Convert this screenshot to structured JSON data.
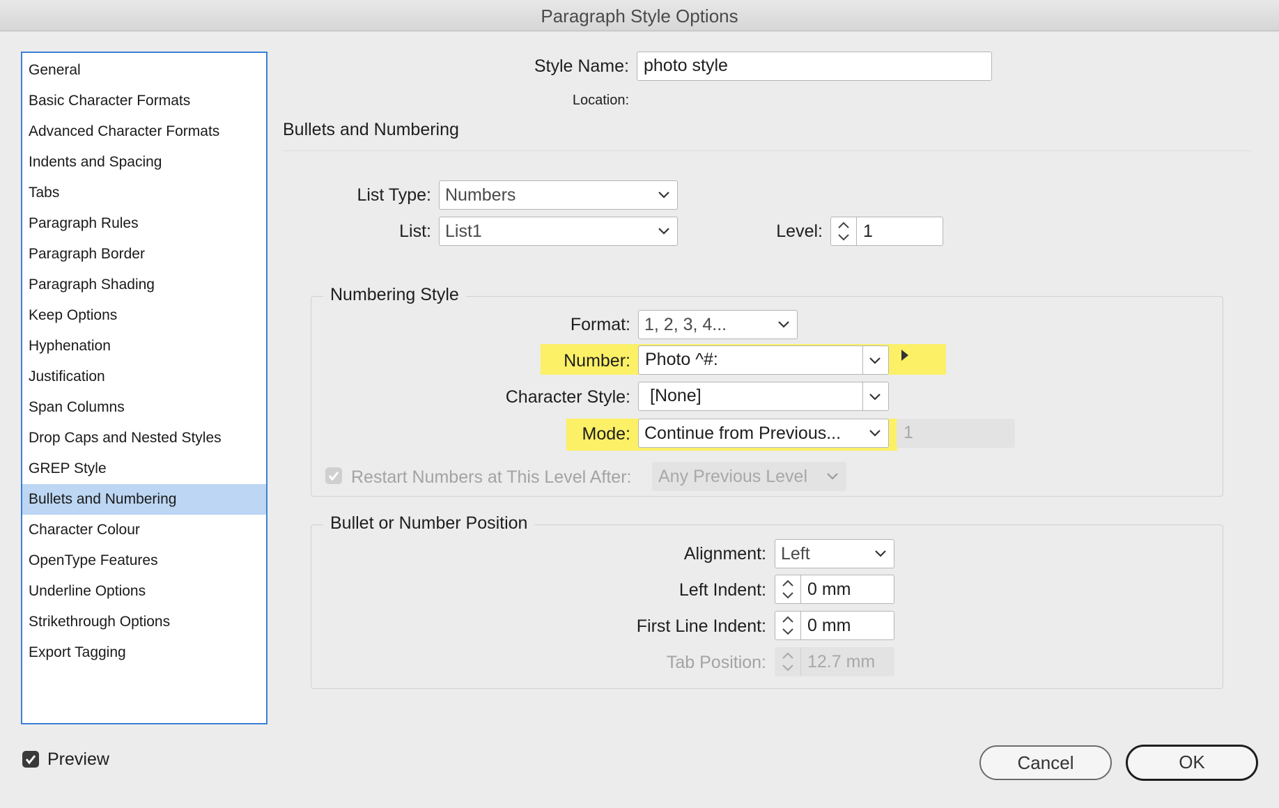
{
  "window": {
    "title": "Paragraph Style Options"
  },
  "sidebar": {
    "items": [
      {
        "label": "General"
      },
      {
        "label": "Basic Character Formats"
      },
      {
        "label": "Advanced Character Formats"
      },
      {
        "label": "Indents and Spacing"
      },
      {
        "label": "Tabs"
      },
      {
        "label": "Paragraph Rules"
      },
      {
        "label": "Paragraph Border"
      },
      {
        "label": "Paragraph Shading"
      },
      {
        "label": "Keep Options"
      },
      {
        "label": "Hyphenation"
      },
      {
        "label": "Justification"
      },
      {
        "label": "Span Columns"
      },
      {
        "label": "Drop Caps and Nested Styles"
      },
      {
        "label": "GREP Style"
      },
      {
        "label": "Bullets and Numbering",
        "selected": true
      },
      {
        "label": "Character Colour"
      },
      {
        "label": "OpenType Features"
      },
      {
        "label": "Underline Options"
      },
      {
        "label": "Strikethrough Options"
      },
      {
        "label": "Export Tagging"
      }
    ]
  },
  "header": {
    "style_name_label": "Style Name:",
    "style_name_value": "photo style",
    "location_label": "Location:",
    "section_title": "Bullets and Numbering"
  },
  "list_settings": {
    "list_type_label": "List Type:",
    "list_type_value": "Numbers",
    "list_label": "List:",
    "list_value": "List1",
    "level_label": "Level:",
    "level_value": "1"
  },
  "numbering_style": {
    "title": "Numbering Style",
    "format_label": "Format:",
    "format_value": "1, 2, 3, 4...",
    "number_label": "Number:",
    "number_value": "Photo ^#:",
    "char_style_label": "Character Style:",
    "char_style_value": "[None]",
    "mode_label": "Mode:",
    "mode_value": "Continue from Previous...",
    "mode_start_value": "1",
    "restart_label": "Restart Numbers at This Level After:",
    "restart_value": "Any Previous Level",
    "restart_checked": true
  },
  "position": {
    "title": "Bullet or Number Position",
    "alignment_label": "Alignment:",
    "alignment_value": "Left",
    "left_indent_label": "Left Indent:",
    "left_indent_value": "0 mm",
    "first_line_label": "First Line Indent:",
    "first_line_value": "0 mm",
    "tab_position_label": "Tab Position:",
    "tab_position_value": "12.7 mm"
  },
  "footer": {
    "preview_label": "Preview",
    "preview_checked": true,
    "cancel_label": "Cancel",
    "ok_label": "OK"
  },
  "colors": {
    "highlight": "#fbf066",
    "selection": "#bcd6f3",
    "focus_border": "#3b7fd6",
    "checkbox": "#3a3a3a"
  }
}
